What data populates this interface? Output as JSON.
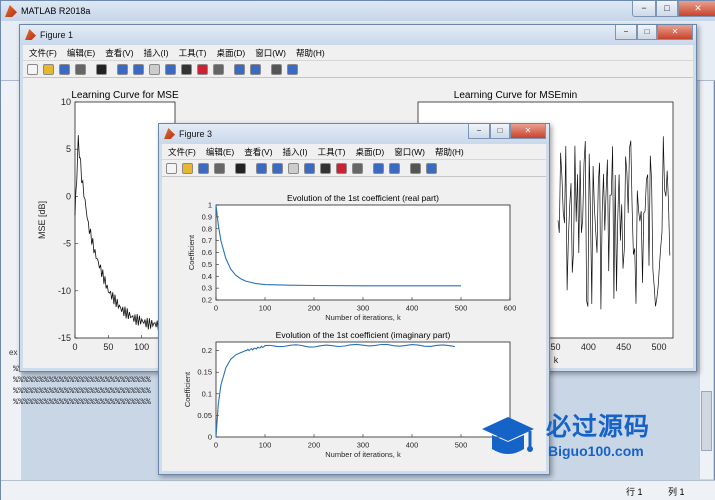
{
  "app": {
    "title": "MATLAB R2018a",
    "console_text": [
      "%%%%%%%%%%%%%%%%%%%%%%%%%%%",
      "%%%%%%%%%%%%%%%%%%%%%%%%%%%",
      "%%%%%%%%%%%%%%%%%%%%%%%%%%%",
      "%%%%%%%%%%%%%%%%%%%%%%%%%%%"
    ],
    "ex_text": "ex",
    "status": {
      "row_label": "行",
      "row_value": "1",
      "col_label": "列",
      "col_value": "1"
    },
    "window_controls": {
      "minimize": "−",
      "maximize": "□",
      "close": "✕"
    }
  },
  "menu": [
    "文件(F)",
    "编辑(E)",
    "查看(V)",
    "插入(I)",
    "工具(T)",
    "桌面(D)",
    "窗口(W)",
    "帮助(H)"
  ],
  "toolbar_icons": [
    "new-figure-icon",
    "open-file-icon",
    "save-icon",
    "print-icon",
    "select-arrow-icon",
    "zoom-in-icon",
    "zoom-out-icon",
    "pan-icon",
    "rotate-icon",
    "data-cursor-icon",
    "brush-icon",
    "link-icon",
    "colorbar-icon",
    "legend-icon",
    "hide-plot-tools-icon",
    "show-plot-tools-icon"
  ],
  "figure1": {
    "title": "Figure 1",
    "chart_title_left": "Learning Curve for MSE",
    "chart_title_right": "Learning Curve for MSEmin",
    "ylabel": "MSE [dB]"
  },
  "figure3": {
    "title": "Figure 3"
  },
  "watermark": {
    "cn": "必过源码",
    "en": "Biguo100.com"
  },
  "chart_data": [
    {
      "type": "line",
      "title": "Learning Curve for MSE",
      "xlabel": "",
      "ylabel": "MSE [dB]",
      "xlim": [
        0,
        500
      ],
      "ylim": [
        -15,
        10
      ],
      "x_ticks": [
        0,
        50,
        100
      ],
      "y_ticks": [
        10,
        5,
        0,
        -5,
        -10,
        -15
      ],
      "series": [
        {
          "x": [
            0,
            5,
            10,
            20,
            30,
            40,
            50,
            60,
            70,
            80,
            90,
            100,
            110,
            120,
            130,
            140,
            150
          ],
          "y": [
            -2,
            6,
            2,
            -3,
            -6,
            -8,
            -10,
            -11,
            -12,
            -12.5,
            -13,
            -13.2,
            -13.5,
            -13.5,
            -13.8,
            -14,
            -14
          ]
        }
      ]
    },
    {
      "type": "line",
      "title": "Learning Curve for MSEmin",
      "xlabel": "k",
      "ylabel": "",
      "xlim": [
        300,
        500
      ],
      "x_ticks": [
        350,
        400,
        450,
        500
      ],
      "series": [
        {
          "style": "noise"
        }
      ]
    },
    {
      "type": "line",
      "title": "Evolution of the 1st coefficient (real part)",
      "xlabel": "Number of iterations, k",
      "ylabel": "Coefficient",
      "xlim": [
        0,
        600
      ],
      "ylim": [
        0.2,
        1.0
      ],
      "x_ticks": [
        0,
        100,
        200,
        300,
        400,
        500,
        600
      ],
      "y_ticks": [
        1.0,
        0.9,
        0.8,
        0.7,
        0.6,
        0.5,
        0.4,
        0.3,
        0.2
      ],
      "y_tick_labels": [
        "1",
        "0.9",
        "0.8",
        "0.7",
        "0.6",
        "0.5",
        "0.4",
        "0.3",
        "0.2"
      ],
      "series": [
        {
          "x": [
            0,
            5,
            10,
            20,
            30,
            40,
            50,
            60,
            80,
            100,
            150,
            200,
            300,
            400,
            500
          ],
          "y": [
            1.0,
            0.82,
            0.7,
            0.55,
            0.46,
            0.41,
            0.38,
            0.36,
            0.34,
            0.33,
            0.325,
            0.322,
            0.32,
            0.32,
            0.32
          ]
        }
      ]
    },
    {
      "type": "line",
      "title": "Evolution of the 1st coefficient (imaginary part)",
      "xlabel": "Number of iterations, k",
      "ylabel": "Coefficient",
      "xlim": [
        0,
        600
      ],
      "ylim": [
        0,
        0.22
      ],
      "x_ticks": [
        0,
        100,
        200,
        300,
        400,
        500,
        600
      ],
      "y_ticks": [
        0.2,
        0.15,
        0.1,
        0.05,
        0
      ],
      "series": [
        {
          "x": [
            0,
            5,
            10,
            20,
            30,
            40,
            60,
            80,
            100,
            150,
            200,
            300,
            400,
            500
          ],
          "y": [
            0.0,
            0.08,
            0.12,
            0.16,
            0.18,
            0.19,
            0.2,
            0.205,
            0.21,
            0.212,
            0.21,
            0.213,
            0.212,
            0.211
          ]
        }
      ]
    }
  ]
}
